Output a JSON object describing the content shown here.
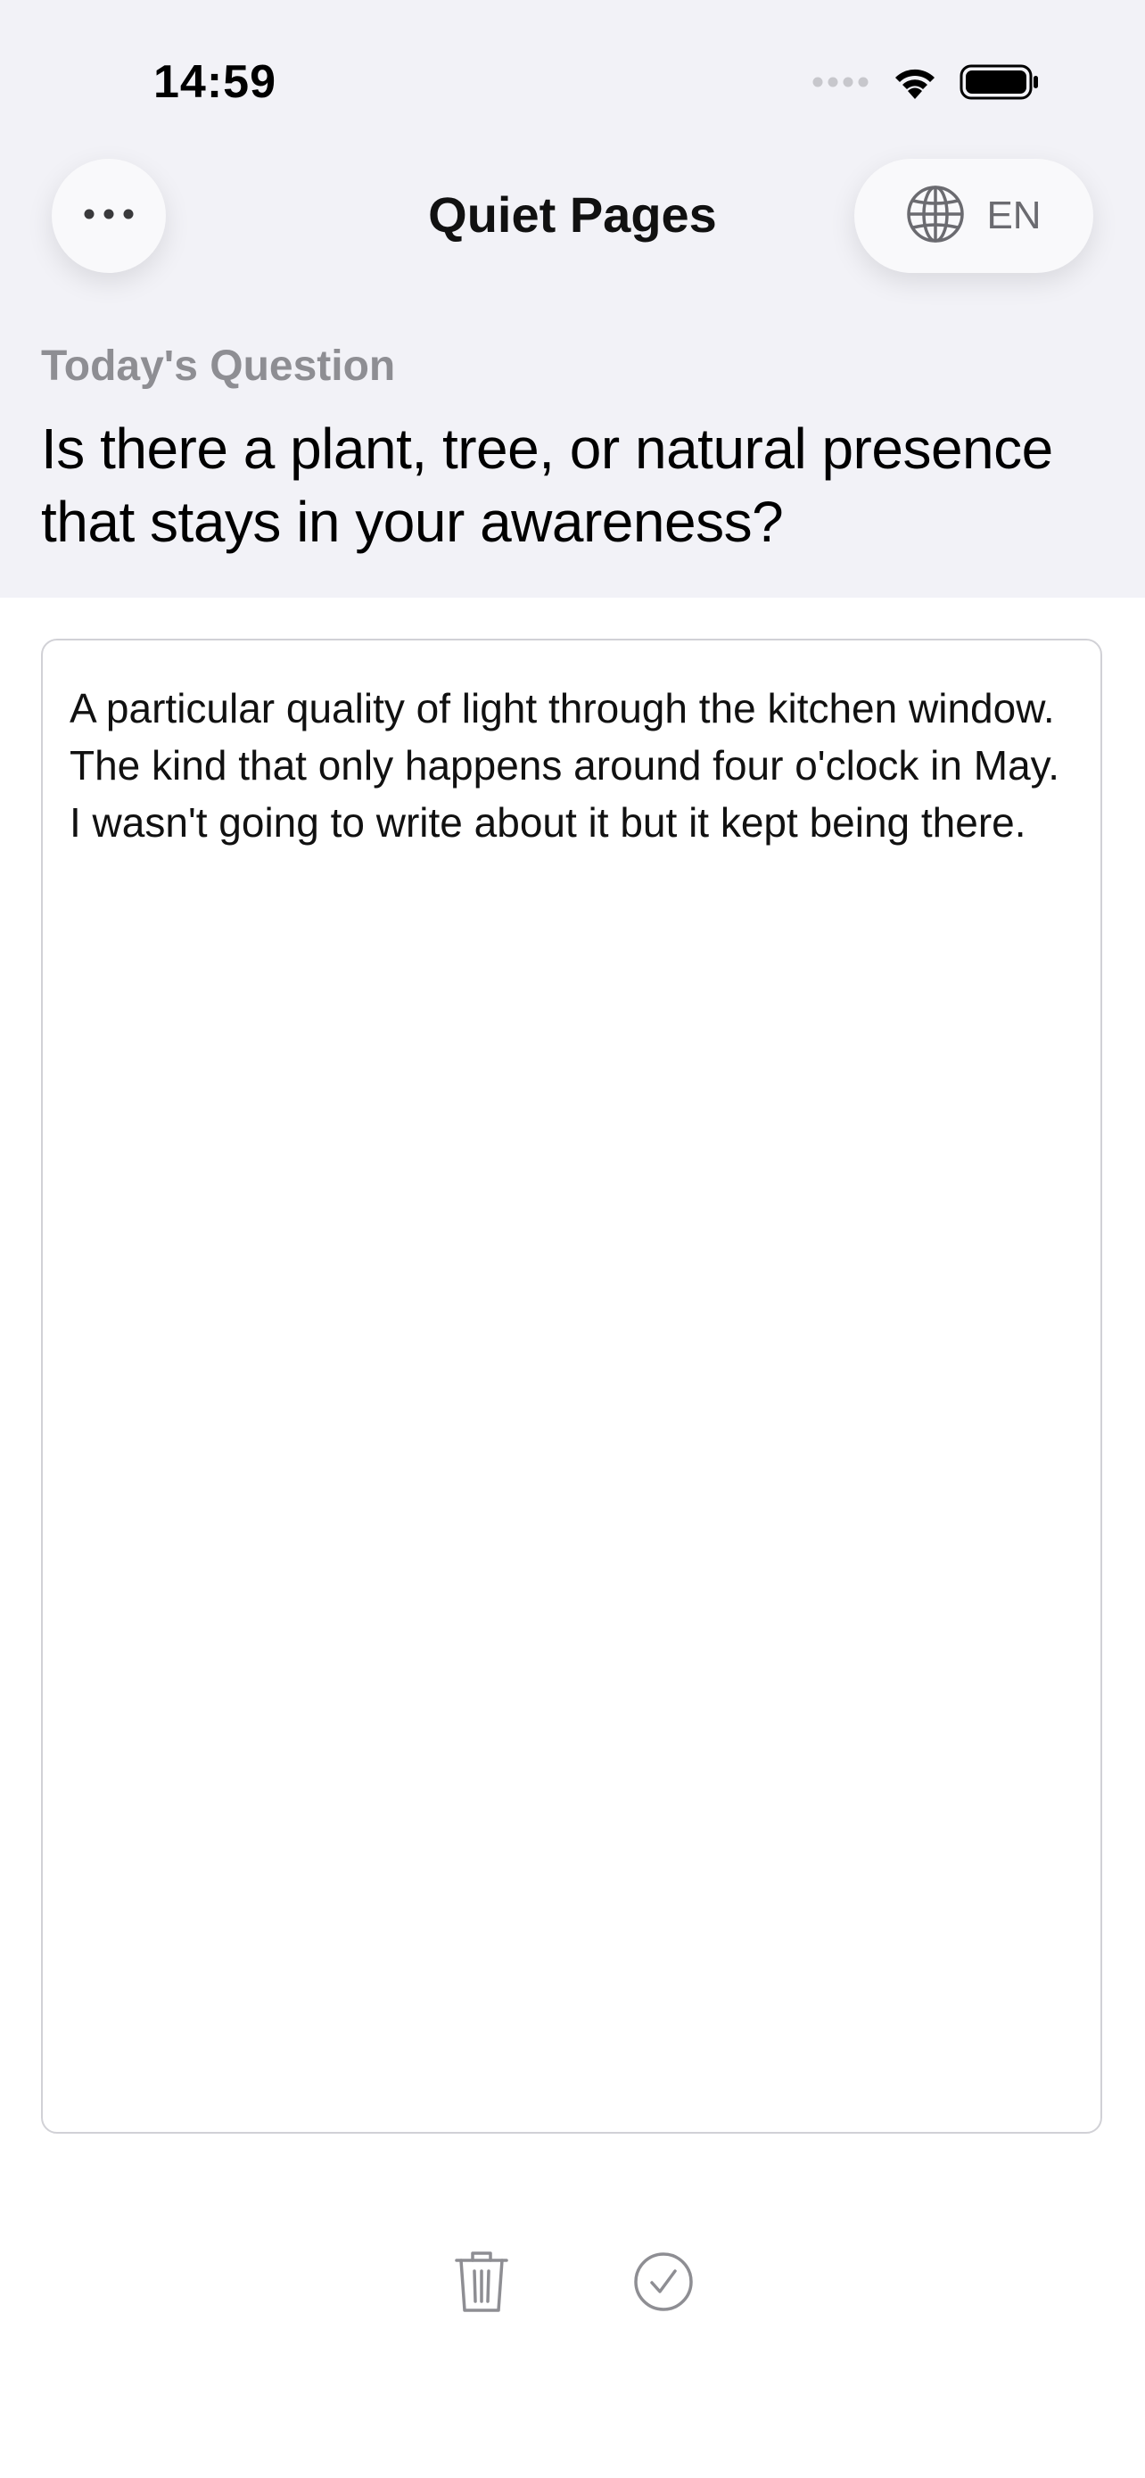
{
  "status_bar": {
    "time": "14:59",
    "icons": [
      "cellular-signal-icon",
      "wifi-icon",
      "battery-icon"
    ]
  },
  "nav": {
    "title": "Quiet Pages",
    "menu_icon": "more-horizontal-icon",
    "language": {
      "icon": "globe-icon",
      "label": "EN"
    }
  },
  "question": {
    "caption": "Today's Question",
    "text": "Is there a plant, tree, or natural presence that stays in your awareness?"
  },
  "entry": {
    "text": "A particular quality of light through the kitchen window. The kind that only happens around four o'clock in May. I wasn't going to write about it but it kept being there."
  },
  "actions": {
    "delete_icon": "trash-icon",
    "done_icon": "checkmark-circle-icon"
  },
  "colors": {
    "header_background": "#f2f2f7",
    "secondary_text": "#8e8e93",
    "icon_gray": "#8e8e93",
    "border": "#d1d1d6"
  }
}
